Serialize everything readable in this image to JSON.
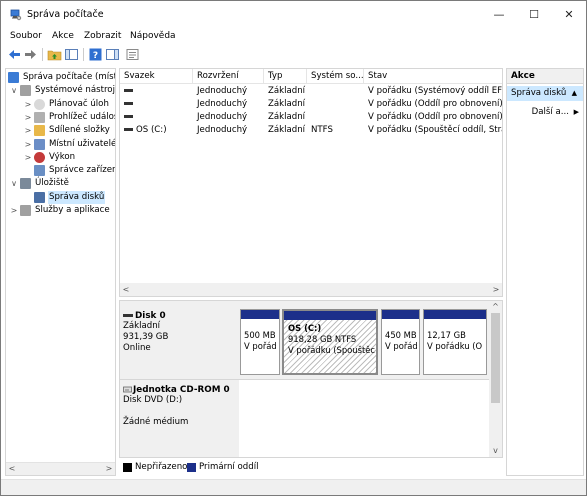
{
  "window": {
    "title": "Správa počítače",
    "minimize_glyph": "—",
    "maximize_glyph": "☐",
    "close_glyph": "✕"
  },
  "menu": [
    {
      "label": "Soubor"
    },
    {
      "label": "Akce"
    },
    {
      "label": "Zobrazit"
    },
    {
      "label": "Nápověda"
    }
  ],
  "toolbar": {
    "icons": [
      "back-arrow-icon",
      "forward-arrow-icon",
      "up-folder-icon",
      "show-hide-tree-icon",
      "help-icon",
      "action-pane-icon",
      "properties-icon"
    ]
  },
  "tree": {
    "items": [
      {
        "label": "Správa počítače (místní)",
        "icon": "computer-management-icon",
        "level": 0,
        "expander": ""
      },
      {
        "label": "Systémové nástroje",
        "icon": "system-tools-icon",
        "level": 1,
        "expander": "∨"
      },
      {
        "label": "Plánovač úloh",
        "icon": "task-scheduler-icon",
        "level": 2,
        "expander": ">"
      },
      {
        "label": "Prohlížeč událostí",
        "icon": "event-viewer-icon",
        "level": 2,
        "expander": ">"
      },
      {
        "label": "Sdílené složky",
        "icon": "shared-folders-icon",
        "level": 2,
        "expander": ">"
      },
      {
        "label": "Místní uživatelé",
        "icon": "local-users-icon",
        "level": 2,
        "expander": ">"
      },
      {
        "label": "Výkon",
        "icon": "performance-icon",
        "level": 2,
        "expander": ">"
      },
      {
        "label": "Správce zařízení",
        "icon": "device-manager-icon",
        "level": 2,
        "expander": ""
      },
      {
        "label": "Úložiště",
        "icon": "storage-icon",
        "level": 1,
        "expander": "∨"
      },
      {
        "label": "Správa disků",
        "icon": "disk-management-icon",
        "level": 2,
        "expander": "",
        "selected": true
      },
      {
        "label": "Služby a aplikace",
        "icon": "services-applications-icon",
        "level": 1,
        "expander": ">"
      }
    ]
  },
  "volumes": {
    "columns": [
      "Svazek",
      "Rozvržení",
      "Typ",
      "Systém so...",
      "Stav"
    ],
    "rows": [
      {
        "svazek": "",
        "rozvrzeni": "Jednoduchý",
        "typ": "Základní",
        "system": "",
        "stav": "V pořádku (Systémový oddíl EFI)"
      },
      {
        "svazek": "",
        "rozvrzeni": "Jednoduchý",
        "typ": "Základní",
        "system": "",
        "stav": "V pořádku (Oddíl pro obnovení)"
      },
      {
        "svazek": "",
        "rozvrzeni": "Jednoduchý",
        "typ": "Základní",
        "system": "",
        "stav": "V pořádku (Oddíl pro obnovení)"
      },
      {
        "svazek": "OS (C:)",
        "rozvrzeni": "Jednoduchý",
        "typ": "Základní",
        "system": "NTFS",
        "stav": "V pořádku (Spouštěcí oddíl, Stránk"
      }
    ]
  },
  "disks": [
    {
      "name": "Disk 0",
      "lines": [
        "Základní",
        "931,39 GB",
        "Online"
      ],
      "partitions": [
        {
          "title": "",
          "size": "500 MB",
          "status": "V pořád"
        },
        {
          "title": "OS  (C:)",
          "size": "918,28 GB NTFS",
          "status": "V pořádku (Spouštěc"
        },
        {
          "title": "",
          "size": "450 MB",
          "status": "V pořád"
        },
        {
          "title": "",
          "size": "12,17 GB",
          "status": "V pořádku (O"
        }
      ]
    },
    {
      "name": "Jednotka CD-ROM 0",
      "lines": [
        "Disk DVD (D:)",
        "",
        "Žádné médium"
      ]
    }
  ],
  "legend": [
    {
      "label": "Nepřiřazeno",
      "color": "#000000"
    },
    {
      "label": "Primární oddíl",
      "color": "#1c2f8a"
    }
  ],
  "actions": {
    "header": "Akce",
    "selected": "Správa disků",
    "more": "Další a..."
  },
  "colors": {
    "primary_partition": "#1c2f8a",
    "selection": "#cce8ff"
  }
}
